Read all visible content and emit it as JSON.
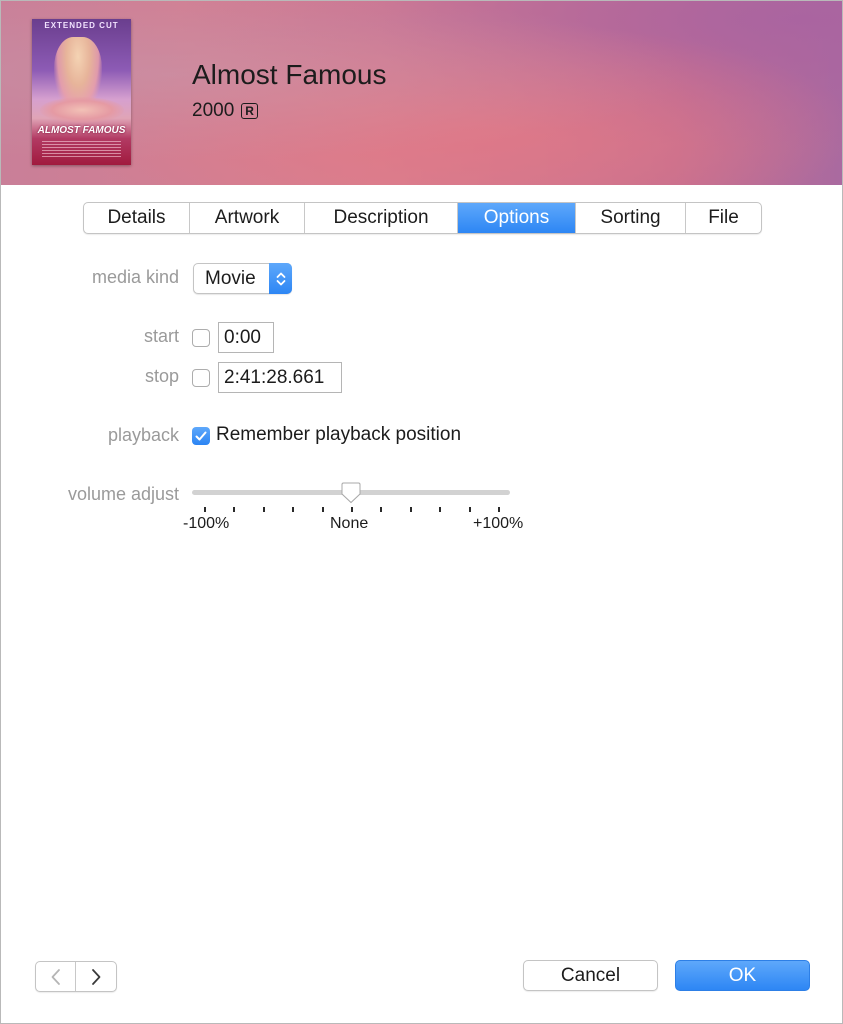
{
  "header": {
    "poster": {
      "top_text": "EXTENDED CUT",
      "title_text": "ALMOST FAMOUS"
    },
    "title": "Almost Famous",
    "year": "2000",
    "rating": "R"
  },
  "tabs": [
    {
      "label": "Details",
      "active": false
    },
    {
      "label": "Artwork",
      "active": false
    },
    {
      "label": "Description",
      "active": false
    },
    {
      "label": "Options",
      "active": true
    },
    {
      "label": "Sorting",
      "active": false
    },
    {
      "label": "File",
      "active": false
    }
  ],
  "options": {
    "media_kind": {
      "label": "media kind",
      "value": "Movie"
    },
    "start": {
      "label": "start",
      "checked": false,
      "value": "0:00"
    },
    "stop": {
      "label": "stop",
      "checked": false,
      "value": "2:41:28.661"
    },
    "playback": {
      "label": "playback",
      "checked": true,
      "checkbox_label": "Remember playback position"
    },
    "volume_adjust": {
      "label": "volume adjust",
      "value_percent": 0,
      "range": [
        -100,
        100
      ],
      "tick_count": 11,
      "min_label": "-100%",
      "mid_label": "None",
      "max_label": "+100%"
    }
  },
  "footer": {
    "prev_icon": "chevron-left-icon",
    "next_icon": "chevron-right-icon",
    "prev_enabled": false,
    "next_enabled": true,
    "cancel_label": "Cancel",
    "ok_label": "OK"
  },
  "colors": {
    "accent": "#2d86f4",
    "header_tint": "#d9808f"
  }
}
